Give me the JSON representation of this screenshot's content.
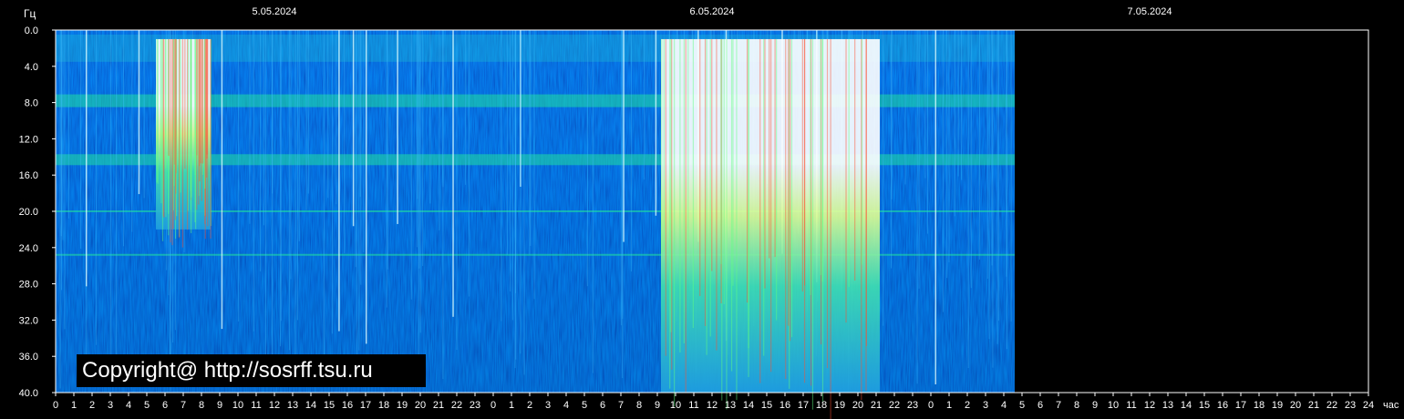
{
  "chart_data": {
    "type": "heatmap",
    "title": "",
    "ylabel": "Гц",
    "xlabel": "час",
    "ylim": [
      0,
      40
    ],
    "y_ticks": [
      "0.0",
      "4.0",
      "8.0",
      "12.0",
      "16.0",
      "20.0",
      "24.0",
      "28.0",
      "32.0",
      "36.0",
      "40.0"
    ],
    "x_ticks": [
      "0",
      "1",
      "2",
      "3",
      "4",
      "5",
      "6",
      "7",
      "8",
      "9",
      "10",
      "11",
      "12",
      "13",
      "14",
      "15",
      "16",
      "17",
      "18",
      "19",
      "20",
      "21",
      "22",
      "23",
      "0",
      "1",
      "2",
      "3",
      "4",
      "5",
      "6",
      "7",
      "8",
      "9",
      "10",
      "11",
      "12",
      "13",
      "14",
      "15",
      "16",
      "17",
      "18",
      "19",
      "20",
      "21",
      "22",
      "23",
      "0",
      "1",
      "2",
      "3",
      "4",
      "5",
      "6",
      "7",
      "8",
      "9",
      "10",
      "11",
      "12",
      "13",
      "14",
      "15",
      "16",
      "17",
      "18",
      "19",
      "20",
      "21",
      "22",
      "23",
      "24"
    ],
    "dates": [
      "5.05.2024",
      "6.05.2024",
      "7.05.2024"
    ],
    "data_end_hour": 52.6,
    "total_hours": 72,
    "resonance_bands_hz": [
      7.8,
      14.3,
      20.0,
      24.8
    ],
    "intense_periods": [
      {
        "start_hour": 5.5,
        "end_hour": 8.5,
        "top_hz": 1,
        "bottom_hz": 22
      },
      {
        "start_hour": 33.2,
        "end_hour": 45.2,
        "top_hz": 1,
        "bottom_hz": 40
      }
    ],
    "background_color": "#0000c8",
    "band_color": "#20e0a0",
    "intense_color": "#ffffff",
    "grid": false,
    "legend": "none"
  },
  "copyright": "Copyright@ http://sosrff.tsu.ru"
}
